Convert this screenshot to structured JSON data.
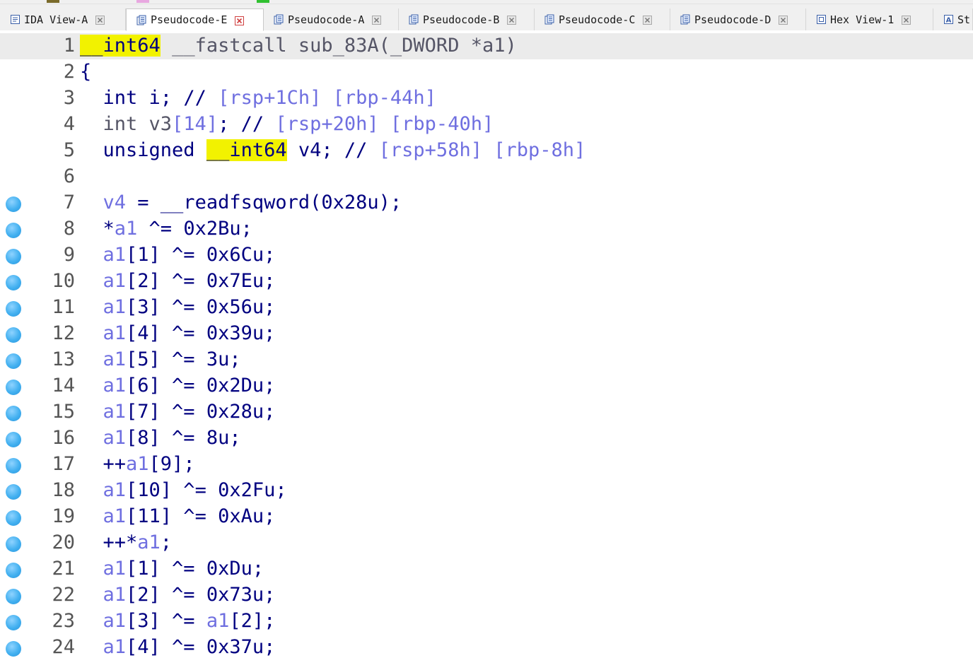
{
  "markers": [
    {
      "color": "#7a6a2a"
    },
    {
      "color": "#e8a8e0"
    },
    {
      "color": "#30c030"
    }
  ],
  "tabs": [
    {
      "label": "IDA View-A",
      "icon": "disassembly-view-icon",
      "active": false
    },
    {
      "label": "Pseudocode-E",
      "icon": "pseudocode-icon",
      "active": true
    },
    {
      "label": "Pseudocode-A",
      "icon": "pseudocode-icon",
      "active": false
    },
    {
      "label": "Pseudocode-B",
      "icon": "pseudocode-icon",
      "active": false
    },
    {
      "label": "Pseudocode-C",
      "icon": "pseudocode-icon",
      "active": false
    },
    {
      "label": "Pseudocode-D",
      "icon": "pseudocode-icon",
      "active": false
    },
    {
      "label": "Hex View-1",
      "icon": "hex-view-icon",
      "active": false
    },
    {
      "label": "St",
      "icon": "strings-icon",
      "active": false
    }
  ],
  "colors": {
    "code_text": "#000080",
    "comment": "#6f6fe0",
    "highlight": "#f2f200",
    "breakpoint": "#42b0f0",
    "current_line_bg": "#ebebeb"
  },
  "code_lines": [
    {
      "num": "1",
      "dot": false,
      "current": true,
      "tokens": [
        [
          "hl",
          "__int64"
        ],
        [
          "plain",
          " "
        ],
        [
          "dim",
          "__fastcall sub_83A(_DWORD *a1)"
        ]
      ]
    },
    {
      "num": "2",
      "dot": false,
      "tokens": [
        [
          "plain",
          "{"
        ]
      ]
    },
    {
      "num": "3",
      "dot": false,
      "tokens": [
        [
          "plain",
          "  int i; "
        ],
        [
          "plain",
          "// "
        ],
        [
          "comment",
          "[rsp+1Ch] [rbp-44h]"
        ]
      ]
    },
    {
      "num": "4",
      "dot": false,
      "tokens": [
        [
          "dim",
          "  int v3"
        ],
        [
          "comment",
          "[14]"
        ],
        [
          "plain",
          "; // "
        ],
        [
          "comment",
          "[rsp+20h] [rbp-40h]"
        ]
      ]
    },
    {
      "num": "5",
      "dot": false,
      "tokens": [
        [
          "plain",
          "  unsigned "
        ],
        [
          "hl",
          "__int64"
        ],
        [
          "plain",
          " v4; // "
        ],
        [
          "comment",
          "[rsp+58h] [rbp-8h]"
        ]
      ]
    },
    {
      "num": "6",
      "dot": false,
      "tokens": [
        [
          "plain",
          ""
        ]
      ]
    },
    {
      "num": "7",
      "dot": true,
      "tokens": [
        [
          "plain",
          "  "
        ],
        [
          "var",
          "v4"
        ],
        [
          "plain",
          " = __readfsqword(0x28u);"
        ]
      ]
    },
    {
      "num": "8",
      "dot": true,
      "tokens": [
        [
          "plain",
          "  *"
        ],
        [
          "var",
          "a1"
        ],
        [
          "plain",
          " ^= 0x2Bu;"
        ]
      ]
    },
    {
      "num": "9",
      "dot": true,
      "tokens": [
        [
          "plain",
          "  "
        ],
        [
          "var",
          "a1"
        ],
        [
          "plain",
          "[1] ^= 0x6Cu;"
        ]
      ]
    },
    {
      "num": "10",
      "dot": true,
      "tokens": [
        [
          "plain",
          "  "
        ],
        [
          "var",
          "a1"
        ],
        [
          "plain",
          "[2] ^= 0x7Eu;"
        ]
      ]
    },
    {
      "num": "11",
      "dot": true,
      "tokens": [
        [
          "plain",
          "  "
        ],
        [
          "var",
          "a1"
        ],
        [
          "plain",
          "[3] ^= 0x56u;"
        ]
      ]
    },
    {
      "num": "12",
      "dot": true,
      "tokens": [
        [
          "plain",
          "  "
        ],
        [
          "var",
          "a1"
        ],
        [
          "plain",
          "[4] ^= 0x39u;"
        ]
      ]
    },
    {
      "num": "13",
      "dot": true,
      "tokens": [
        [
          "plain",
          "  "
        ],
        [
          "var",
          "a1"
        ],
        [
          "plain",
          "[5] ^= 3u;"
        ]
      ]
    },
    {
      "num": "14",
      "dot": true,
      "tokens": [
        [
          "plain",
          "  "
        ],
        [
          "var",
          "a1"
        ],
        [
          "plain",
          "[6] ^= 0x2Du;"
        ]
      ]
    },
    {
      "num": "15",
      "dot": true,
      "tokens": [
        [
          "plain",
          "  "
        ],
        [
          "var",
          "a1"
        ],
        [
          "plain",
          "[7] ^= 0x28u;"
        ]
      ]
    },
    {
      "num": "16",
      "dot": true,
      "tokens": [
        [
          "plain",
          "  "
        ],
        [
          "var",
          "a1"
        ],
        [
          "plain",
          "[8] ^= 8u;"
        ]
      ]
    },
    {
      "num": "17",
      "dot": true,
      "tokens": [
        [
          "plain",
          "  ++"
        ],
        [
          "var",
          "a1"
        ],
        [
          "plain",
          "[9];"
        ]
      ]
    },
    {
      "num": "18",
      "dot": true,
      "tokens": [
        [
          "plain",
          "  "
        ],
        [
          "var",
          "a1"
        ],
        [
          "plain",
          "[10] ^= 0x2Fu;"
        ]
      ]
    },
    {
      "num": "19",
      "dot": true,
      "tokens": [
        [
          "plain",
          "  "
        ],
        [
          "var",
          "a1"
        ],
        [
          "plain",
          "[11] ^= 0xAu;"
        ]
      ]
    },
    {
      "num": "20",
      "dot": true,
      "tokens": [
        [
          "plain",
          "  ++*"
        ],
        [
          "var",
          "a1"
        ],
        [
          "plain",
          ";"
        ]
      ]
    },
    {
      "num": "21",
      "dot": true,
      "tokens": [
        [
          "plain",
          "  "
        ],
        [
          "var",
          "a1"
        ],
        [
          "plain",
          "[1] ^= 0xDu;"
        ]
      ]
    },
    {
      "num": "22",
      "dot": true,
      "tokens": [
        [
          "plain",
          "  "
        ],
        [
          "var",
          "a1"
        ],
        [
          "plain",
          "[2] ^= 0x73u;"
        ]
      ]
    },
    {
      "num": "23",
      "dot": true,
      "tokens": [
        [
          "plain",
          "  "
        ],
        [
          "var",
          "a1"
        ],
        [
          "plain",
          "[3] ^= "
        ],
        [
          "var",
          "a1"
        ],
        [
          "plain",
          "[2];"
        ]
      ]
    },
    {
      "num": "24",
      "dot": true,
      "tokens": [
        [
          "plain",
          "  "
        ],
        [
          "var",
          "a1"
        ],
        [
          "plain",
          "[4] ^= 0x37u;"
        ]
      ]
    }
  ]
}
